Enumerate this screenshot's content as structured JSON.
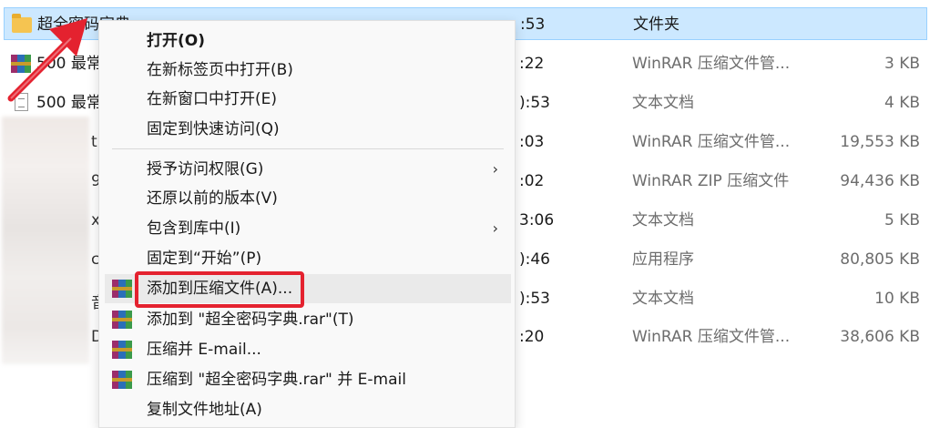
{
  "files": [
    {
      "name": "超全密码字典",
      "time": ":53",
      "type": "文件夹",
      "size": "",
      "icon": "folder-icon",
      "selected": true
    },
    {
      "name": "500 最常",
      "time": ":22",
      "type": "WinRAR 压缩文件管...",
      "size": "3 KB",
      "icon": "winrar-icon"
    },
    {
      "name": "500 最常",
      "time": "):53",
      "type": "文本文档",
      "size": "4 KB",
      "icon": "text-file-icon"
    },
    {
      "name": "t",
      "time": ":03",
      "type": "WinRAR 压缩文件管...",
      "size": "19,553 KB",
      "icon": "winrar-icon"
    },
    {
      "name": "9",
      "time": ":02",
      "type": "WinRAR ZIP 压缩文件",
      "size": "94,436 KB",
      "icon": "winrar-icon"
    },
    {
      "name": "x",
      "time": "3:06",
      "type": "文本文档",
      "size": "5 KB",
      "icon": "text-file-icon"
    },
    {
      "name": "c",
      "time": "):46",
      "type": "应用程序",
      "size": "80,805 KB",
      "icon": "app-icon"
    },
    {
      "name": "音",
      "time": "):53",
      "type": "文本文档",
      "size": "10 KB",
      "icon": "text-file-icon"
    },
    {
      "name": "D",
      "time": ":20",
      "type": "WinRAR 压缩文件管...",
      "size": "38,606 KB",
      "icon": "winrar-icon"
    }
  ],
  "menu": {
    "open": "打开(O)",
    "open_new_tab": "在新标签页中打开(B)",
    "open_new_window": "在新窗口中打开(E)",
    "pin_quick_access": "固定到快速访问(Q)",
    "grant_access": "授予访问权限(G)",
    "restore_versions": "还原以前的版本(V)",
    "include_library": "包含到库中(I)",
    "pin_start": "固定到“开始”(P)",
    "add_archive": "添加到压缩文件(A)...",
    "add_to_rar": "添加到 \"超全密码字典.rar\"(T)",
    "compress_email": "压缩并 E-mail...",
    "compress_rar_email": "压缩到 \"超全密码字典.rar\" 并 E-mail",
    "copy_path": "复制文件地址(A)",
    "submenu_chevron": "›"
  },
  "colors": {
    "selection": "#cce8ff",
    "highlight_border": "#e4222f",
    "arrow": "#e4222f"
  }
}
